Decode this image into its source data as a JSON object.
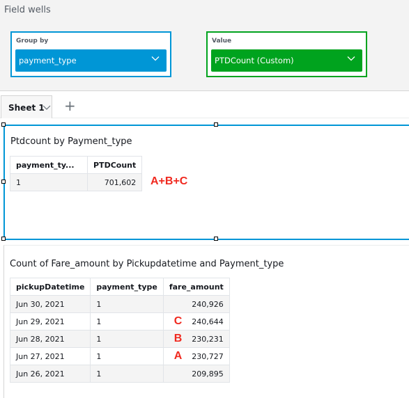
{
  "field_wells": {
    "title": "Field wells",
    "group_by": {
      "label": "Group by",
      "value": "payment_type",
      "color": "#0096d6"
    },
    "value": {
      "label": "Value",
      "value": "PTDCount (Custom)",
      "color": "#00a31e"
    }
  },
  "tabs": {
    "active": "Sheet 1",
    "add_icon": "plus-icon"
  },
  "visual1": {
    "title": "Ptdcount by Payment_type",
    "headers": [
      "payment_ty...",
      "PTDCount"
    ],
    "rows": [
      [
        "1",
        "701,602"
      ]
    ],
    "annotation": "A+B+C"
  },
  "visual2": {
    "title": "Count of Fare_amount by Pickupdatetime and Payment_type",
    "headers": [
      "pickupDatetime",
      "payment_type",
      "fare_amount"
    ],
    "rows": [
      [
        "Jun 30, 2021",
        "1",
        "240,926",
        ""
      ],
      [
        "Jun 29, 2021",
        "1",
        "240,644",
        "C"
      ],
      [
        "Jun 28, 2021",
        "1",
        "230,231",
        "B"
      ],
      [
        "Jun 27, 2021",
        "1",
        "230,727",
        "A"
      ],
      [
        "Jun 26, 2021",
        "1",
        "209,895",
        ""
      ]
    ]
  }
}
